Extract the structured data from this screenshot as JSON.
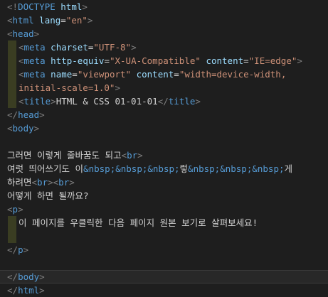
{
  "editor": {
    "background": "#1e1e1e",
    "colors": {
      "punctuation": "#808080",
      "tag": "#569cd6",
      "attribute": "#9cdcfe",
      "string": "#ce9178",
      "entity": "#569cd6",
      "text": "#d4d4d4"
    },
    "lines": [
      [
        [
          "punct",
          "<!"
        ],
        [
          "tag",
          "DOCTYPE"
        ],
        [
          "plain",
          " "
        ],
        [
          "attr",
          "html"
        ],
        [
          "punct",
          ">"
        ]
      ],
      [
        [
          "punct",
          "<"
        ],
        [
          "tag",
          "html"
        ],
        [
          "plain",
          " "
        ],
        [
          "attr",
          "lang"
        ],
        [
          "plain",
          "="
        ],
        [
          "str",
          "\"en\""
        ],
        [
          "punct",
          ">"
        ]
      ],
      [
        [
          "punct",
          "<"
        ],
        [
          "tag",
          "head"
        ],
        [
          "punct",
          ">"
        ]
      ],
      [
        [
          "punct",
          "<"
        ],
        [
          "tag",
          "meta"
        ],
        [
          "plain",
          " "
        ],
        [
          "attr",
          "charset"
        ],
        [
          "plain",
          "="
        ],
        [
          "str",
          "\"UTF-8\""
        ],
        [
          "punct",
          ">"
        ]
      ],
      [
        [
          "punct",
          "<"
        ],
        [
          "tag",
          "meta"
        ],
        [
          "plain",
          " "
        ],
        [
          "attr",
          "http-equiv"
        ],
        [
          "plain",
          "="
        ],
        [
          "str",
          "\"X-UA-Compatible\""
        ],
        [
          "plain",
          " "
        ],
        [
          "attr",
          "content"
        ],
        [
          "plain",
          "="
        ],
        [
          "str",
          "\"IE=edge\""
        ],
        [
          "punct",
          ">"
        ]
      ],
      [
        [
          "punct",
          "<"
        ],
        [
          "tag",
          "meta"
        ],
        [
          "plain",
          " "
        ],
        [
          "attr",
          "name"
        ],
        [
          "plain",
          "="
        ],
        [
          "str",
          "\"viewport\""
        ],
        [
          "plain",
          " "
        ],
        [
          "attr",
          "content"
        ],
        [
          "plain",
          "="
        ],
        [
          "str",
          "\"width=device-width,"
        ]
      ],
      [
        [
          "str",
          "initial-scale=1.0\""
        ],
        [
          "punct",
          ">"
        ]
      ],
      [
        [
          "punct",
          "<"
        ],
        [
          "tag",
          "title"
        ],
        [
          "punct",
          ">"
        ],
        [
          "plain",
          "HTML & CSS 01-01-01"
        ],
        [
          "punct",
          "</"
        ],
        [
          "tag",
          "title"
        ],
        [
          "punct",
          ">"
        ]
      ],
      [
        [
          "punct",
          "</"
        ],
        [
          "tag",
          "head"
        ],
        [
          "punct",
          ">"
        ]
      ],
      [
        [
          "punct",
          "<"
        ],
        [
          "tag",
          "body"
        ],
        [
          "punct",
          ">"
        ]
      ],
      [],
      [
        [
          "plain",
          "그러면 이렇게 줄바꿈도 되고"
        ],
        [
          "punct",
          "<"
        ],
        [
          "tag",
          "br"
        ],
        [
          "punct",
          ">"
        ]
      ],
      [
        [
          "plain",
          "여럿 띄어쓰기도 이"
        ],
        [
          "ent",
          "&nbsp;&nbsp;&nbsp;"
        ],
        [
          "plain",
          "렇"
        ],
        [
          "ent",
          "&nbsp;&nbsp;&nbsp;"
        ],
        [
          "plain",
          "게"
        ]
      ],
      [
        [
          "plain",
          "하려면"
        ],
        [
          "punct",
          "<"
        ],
        [
          "tag",
          "br"
        ],
        [
          "punct",
          ">"
        ],
        [
          "punct",
          "<"
        ],
        [
          "tag",
          "br"
        ],
        [
          "punct",
          ">"
        ]
      ],
      [
        [
          "plain",
          "어떻게 하면 될까요?"
        ]
      ],
      [
        [
          "punct",
          "<"
        ],
        [
          "tag",
          "p"
        ],
        [
          "punct",
          ">"
        ]
      ],
      [
        [
          "plain",
          "이 페이지를 우클릭한 다음 페이지 원본 보기로 살펴보세요!"
        ]
      ],
      [],
      [
        [
          "punct",
          "</"
        ],
        [
          "tag",
          "p"
        ],
        [
          "punct",
          ">"
        ]
      ],
      [],
      [
        [
          "punct",
          "</"
        ],
        [
          "tag",
          "body"
        ],
        [
          "punct",
          ">"
        ]
      ],
      [
        [
          "punct",
          "</"
        ],
        [
          "tag",
          "html"
        ],
        [
          "punct",
          ">"
        ]
      ]
    ]
  }
}
